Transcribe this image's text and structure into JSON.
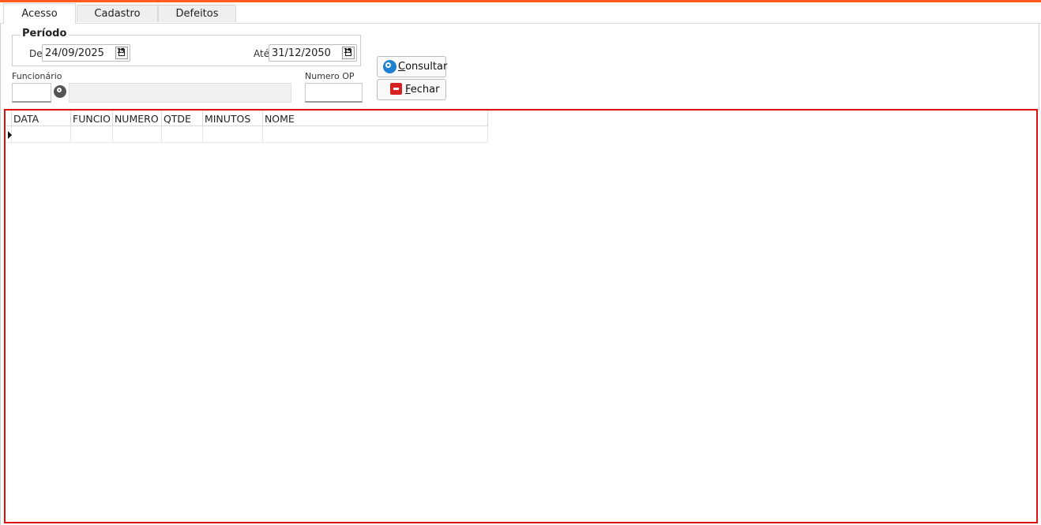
{
  "tabs": [
    {
      "label": "Acesso",
      "active": true
    },
    {
      "label": "Cadastro",
      "active": false
    },
    {
      "label": "Defeitos",
      "active": false
    }
  ],
  "periodo": {
    "title": "Período",
    "de_label": "De",
    "de_value": "24/09/2025",
    "ate_label": "Até",
    "ate_value": "31/12/2050"
  },
  "funcionario": {
    "label": "Funcionário",
    "code_value": "",
    "name_value": ""
  },
  "numero_op": {
    "label": "Numero OP",
    "value": ""
  },
  "buttons": {
    "consultar_first": "C",
    "consultar_rest": "onsultar",
    "fechar_first": "F",
    "fechar_rest": "echar"
  },
  "grid": {
    "columns": [
      "DATA",
      "FUNCIO",
      "NUMERO",
      "QTDE",
      "MINUTOS",
      "NOME"
    ],
    "rows": [
      [
        "",
        "",
        "",
        "",
        "",
        ""
      ]
    ]
  },
  "colors": {
    "accent_bar": "#ff5a1f",
    "grid_border": "#e01010",
    "consultar_icon": "#1f7fd1",
    "fechar_icon": "#d62222"
  }
}
